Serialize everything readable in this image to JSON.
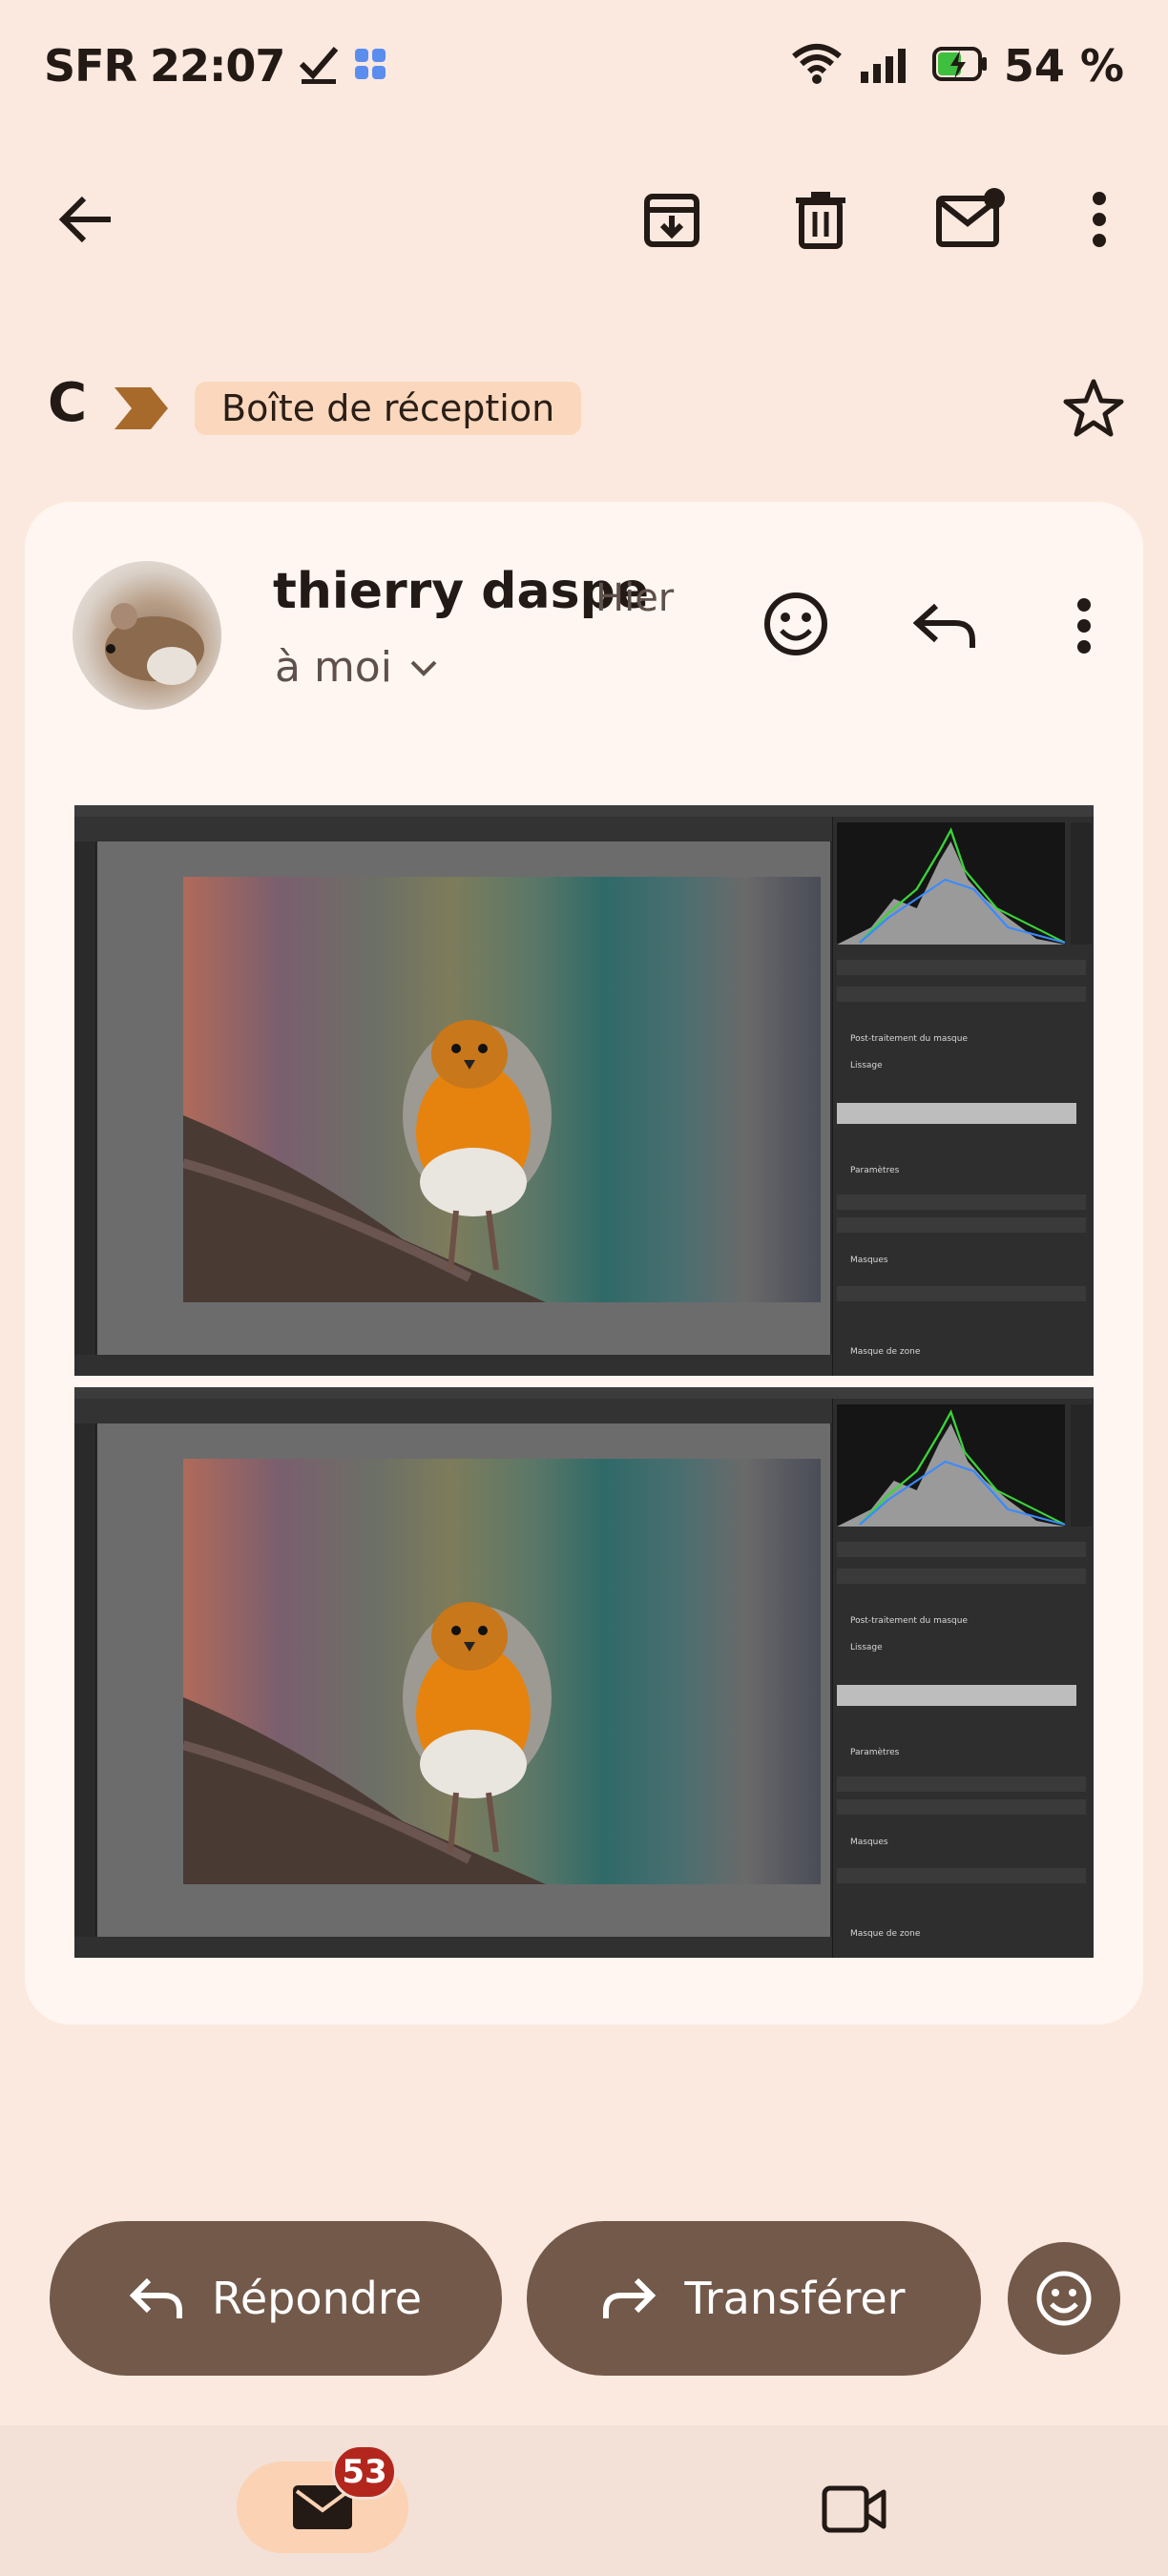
{
  "status_bar": {
    "carrier": "SFR",
    "time": "22:07",
    "battery_percent": "54 %"
  },
  "toolbar": {
    "icons": [
      "back-arrow-icon",
      "archive-icon",
      "delete-icon",
      "mark-unread-icon",
      "more-vert-icon"
    ]
  },
  "thread": {
    "initial": "C",
    "label": "Boîte de réception"
  },
  "message": {
    "sender": "thierry daspe",
    "date": "Hier",
    "recipient": "à moi"
  },
  "attachments": [
    {
      "panel_sections": [
        "Post-traitement du masque",
        "Lissage",
        "Paramètres",
        "Masques",
        "Masque de zone"
      ]
    },
    {
      "panel_sections": [
        "Post-traitement du masque",
        "Lissage",
        "Paramètres",
        "Masques",
        "Masque de zone"
      ]
    }
  ],
  "actions": {
    "reply_label": "Répondre",
    "forward_label": "Transférer"
  },
  "bottom_nav": {
    "mail_badge": "53"
  },
  "colors": {
    "background": "#fbe9e0",
    "card": "#fff6f2",
    "button": "#72594a",
    "chip": "#fbd8bd",
    "badge": "#b3261e"
  }
}
